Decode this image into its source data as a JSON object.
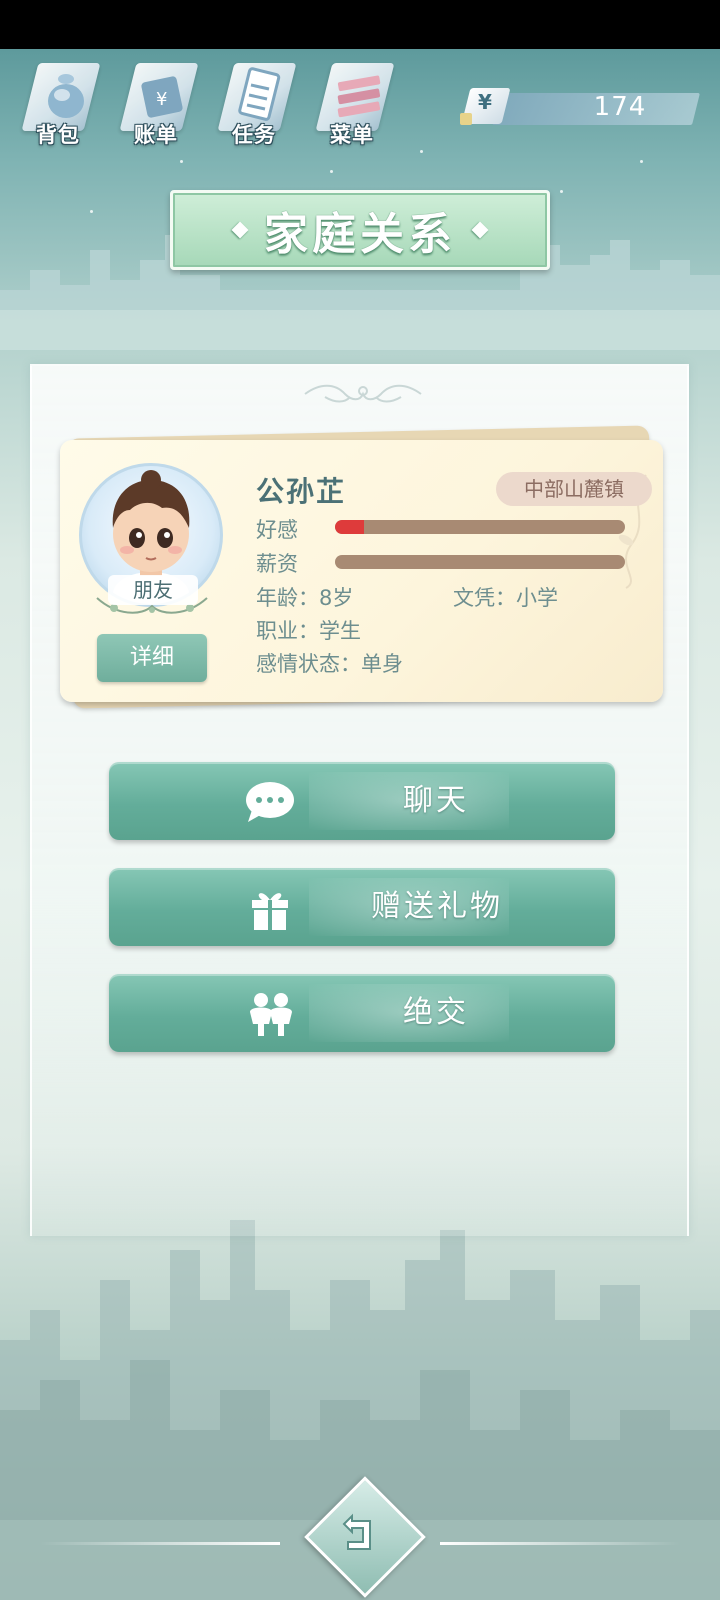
{
  "top_menu": {
    "items": [
      {
        "label": "背包",
        "icon": "backpack-icon"
      },
      {
        "label": "账单",
        "icon": "bill-icon"
      },
      {
        "label": "任务",
        "icon": "task-icon"
      },
      {
        "label": "菜单",
        "icon": "menu-icon"
      }
    ]
  },
  "currency": {
    "symbol": "¥",
    "value": "174"
  },
  "page": {
    "title": "家庭关系"
  },
  "character": {
    "name": "公孙芷",
    "location": "中部山麓镇",
    "relation": "朋友",
    "detail_button": "详细",
    "stats": {
      "affection_label": "好感",
      "affection_value": 0.1,
      "salary_label": "薪资",
      "salary_value": 0
    },
    "info": {
      "age": "年龄：8岁",
      "education": "文凭：小学",
      "job": "职业：学生",
      "relationship_status": "感情状态：单身"
    }
  },
  "actions": [
    {
      "label": "聊天",
      "icon": "chat-bubble-icon"
    },
    {
      "label": "赠送礼物",
      "icon": "gift-icon"
    },
    {
      "label": "绝交",
      "icon": "break-up-icon"
    }
  ],
  "back_button": {
    "icon": "back-arrow-icon"
  },
  "colors": {
    "accent_teal": "#63ad9a",
    "affection_red": "#de3b3b",
    "bar_brown": "#a88a73"
  }
}
